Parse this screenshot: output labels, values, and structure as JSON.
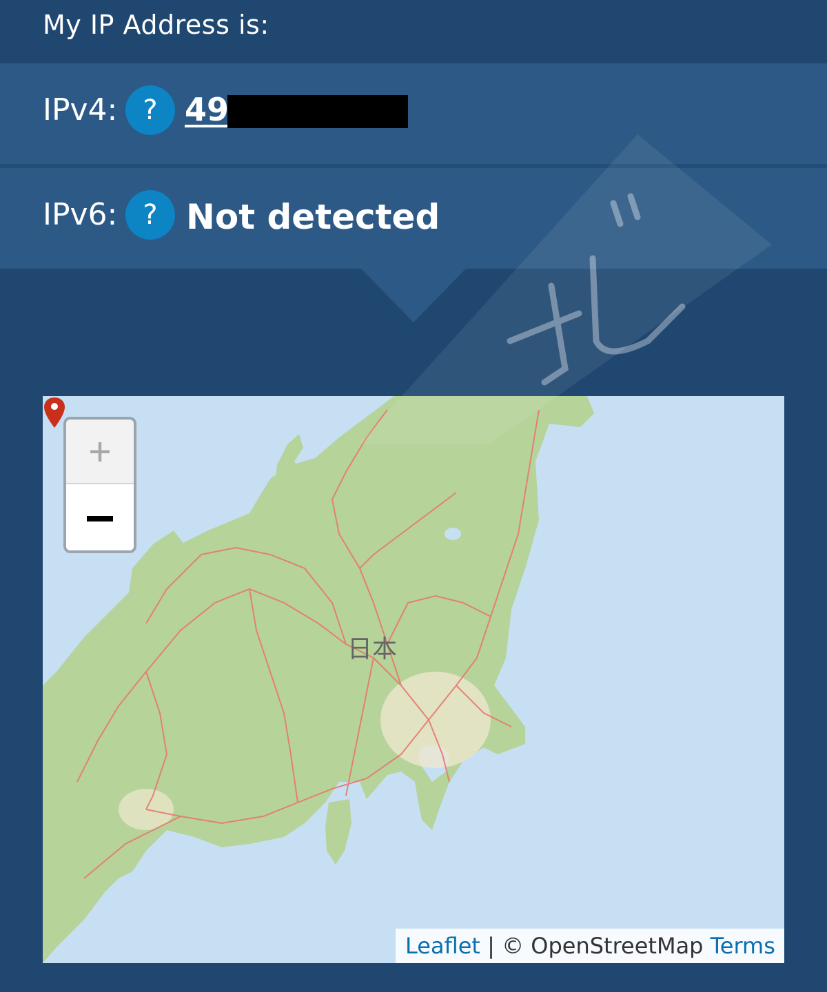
{
  "header": {
    "title": "My IP Address is:"
  },
  "ipv4": {
    "label": "IPv4:",
    "help_label": "?",
    "value": "49."
  },
  "ipv6": {
    "label": "IPv6:",
    "help_label": "?",
    "value": "Not detected"
  },
  "map": {
    "zoom_in_label": "+",
    "place_label": "日本",
    "marker_icon": "location-pin-icon",
    "marker_color": "#c9301c",
    "attribution": {
      "leaflet": "Leaflet",
      "separator": "|",
      "osm": "© OpenStreetMap",
      "terms": "Terms"
    }
  },
  "colors": {
    "background": "#1f4770",
    "row": "#2c5985",
    "help_button": "#0d84c4",
    "map_water": "#c6dff3",
    "map_land": "#b6d39a",
    "map_roads": "#e8786e"
  }
}
